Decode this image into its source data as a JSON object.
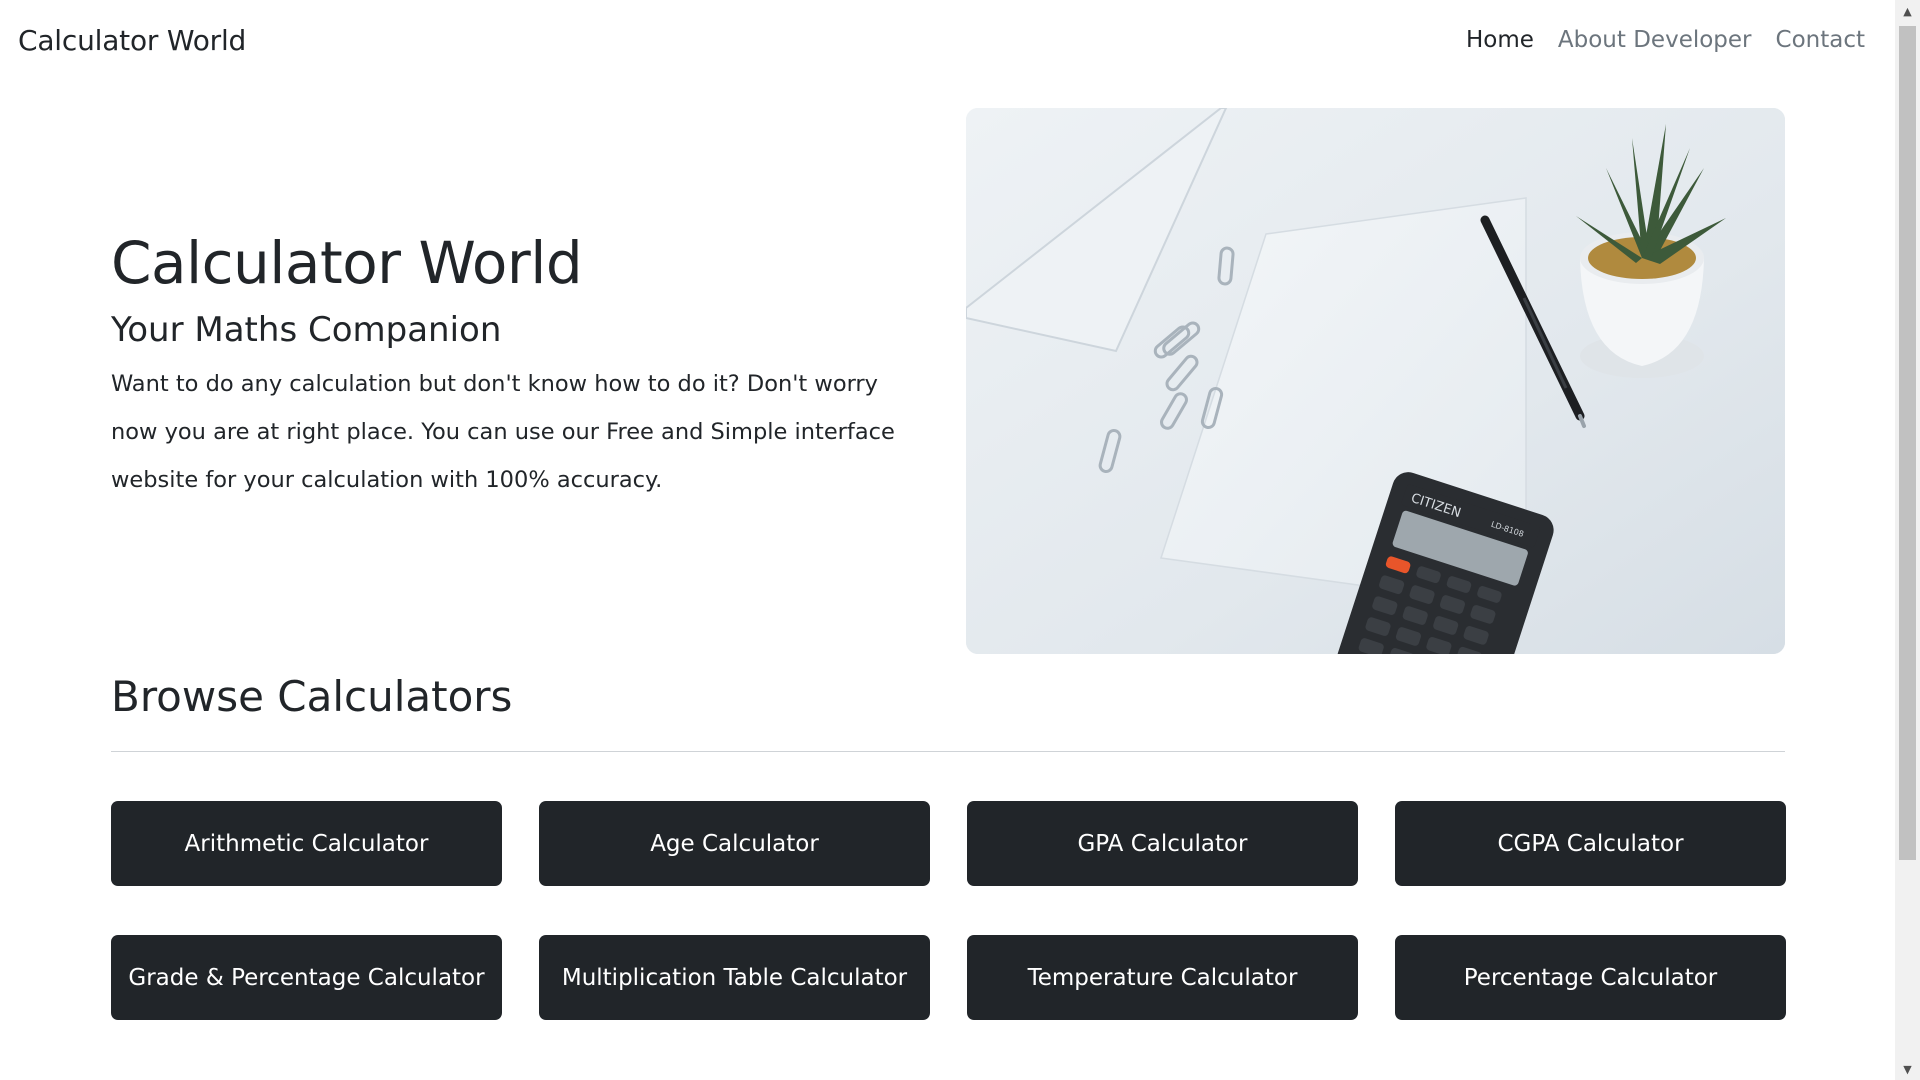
{
  "navbar": {
    "brand": "Calculator World",
    "links": [
      {
        "label": "Home",
        "active": true
      },
      {
        "label": "About Developer",
        "active": false
      },
      {
        "label": "Contact",
        "active": false
      }
    ]
  },
  "hero": {
    "title": "Calculator World",
    "subtitle": "Your Maths Companion",
    "description": "Want to do any calculation but don't know how to do it? Don't worry now you are at right place. You can use our Free and Simple interface website for your calculation with 100% accuracy.",
    "image": {
      "calculator_brand": "CITIZEN",
      "calculator_model": "LD-8108"
    }
  },
  "browse": {
    "title": "Browse Calculators",
    "calculators": [
      "Arithmetic Calculator",
      "Age Calculator",
      "GPA Calculator",
      "CGPA Calculator",
      "Grade & Percentage Calculator",
      "Multiplication Table Calculator",
      "Temperature Calculator",
      "Percentage Calculator"
    ]
  },
  "colors": {
    "dark": "#212529",
    "muted": "#6c757d",
    "accent_key": "#e8552a"
  }
}
